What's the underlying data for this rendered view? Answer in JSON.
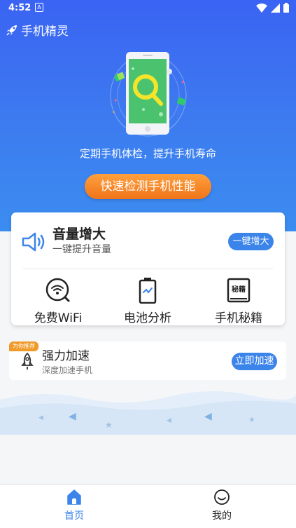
{
  "status_bar": {
    "time": "4:52",
    "notif_letter": "A"
  },
  "app": {
    "title": "手机精灵"
  },
  "hero": {
    "slogan": "定期手机体检，提升手机寿命",
    "detect_button": "快速检测手机性能"
  },
  "volume": {
    "title": "音量增大",
    "subtitle": "一键提升音量",
    "button": "一键增大"
  },
  "tools": [
    {
      "label": "免费WiFi",
      "icon": "wifi-icon"
    },
    {
      "label": "电池分析",
      "icon": "battery-icon"
    },
    {
      "label": "手机秘籍",
      "icon": "book-icon",
      "icon_text": "秘籍"
    }
  ],
  "speedup": {
    "tag": "为你推荐",
    "title": "强力加速",
    "subtitle": "深度加速手机",
    "button": "立即加速"
  },
  "bottom_nav": {
    "items": [
      {
        "label": "首页",
        "active": true
      },
      {
        "label": "我的",
        "active": false
      }
    ]
  },
  "colors": {
    "hero_blue": "#3a63f3",
    "accent_blue": "#3b84ea",
    "orange": "#f0741a",
    "tag_orange": "#f09a2a"
  }
}
